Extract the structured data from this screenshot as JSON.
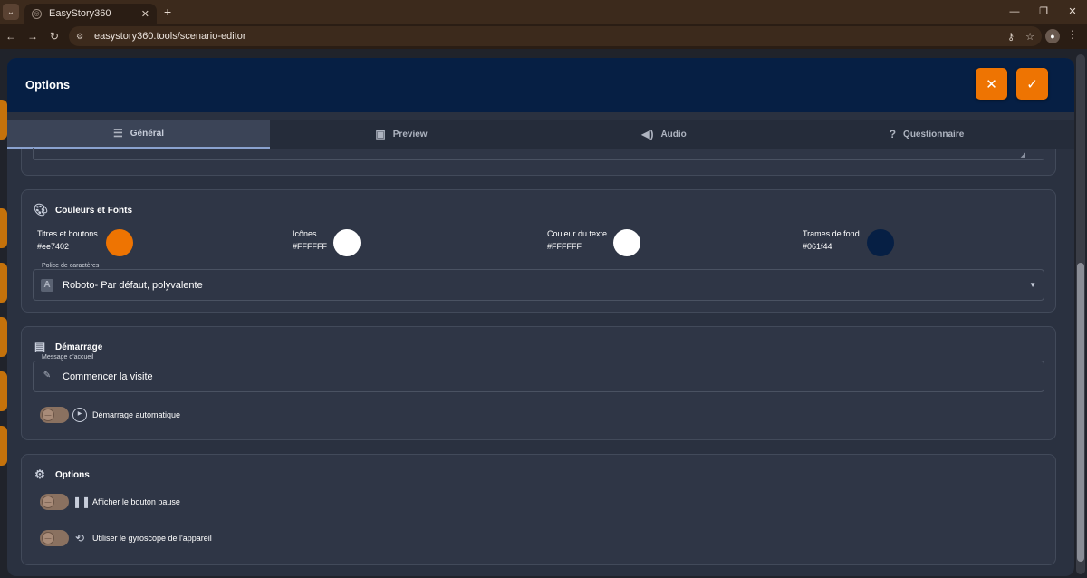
{
  "browser": {
    "tab_title": "EasyStory360",
    "url": "easystory360.tools/scenario-editor"
  },
  "modal": {
    "title": "Options",
    "close_icon": "close-icon",
    "confirm_icon": "check-icon"
  },
  "tabs": [
    {
      "label": "Général",
      "icon": "tune-icon",
      "active": true
    },
    {
      "label": "Preview",
      "icon": "image-icon",
      "active": false
    },
    {
      "label": "Audio",
      "icon": "volume-icon",
      "active": false
    },
    {
      "label": "Questionnaire",
      "icon": "quiz-icon",
      "active": false
    }
  ],
  "colors_card": {
    "title": "Couleurs et Fonts",
    "items": [
      {
        "label": "Titres et boutons",
        "hex": "#ee7402"
      },
      {
        "label": "Icônes",
        "hex": "#FFFFFF"
      },
      {
        "label": "Couleur du texte",
        "hex": "#FFFFFF"
      },
      {
        "label": "Trames de fond",
        "hex": "#061f44"
      }
    ],
    "font_legend": "Police de caractères",
    "font_value": "Roboto- Par défaut, polyvalente",
    "font_badge": "A"
  },
  "start_card": {
    "title": "Démarrage",
    "message_legend": "Message d'accueil",
    "message_value": "Commencer la visite",
    "autostart_label": "Démarrage automatique"
  },
  "options_card": {
    "title": "Options",
    "pause_label": "Afficher le bouton pause",
    "gyro_label": "Utiliser le gyroscope de l'appareil"
  },
  "theme": {
    "accent": "#ee7402",
    "header_bg": "#061f44",
    "modal_bg": "#2a3140"
  }
}
